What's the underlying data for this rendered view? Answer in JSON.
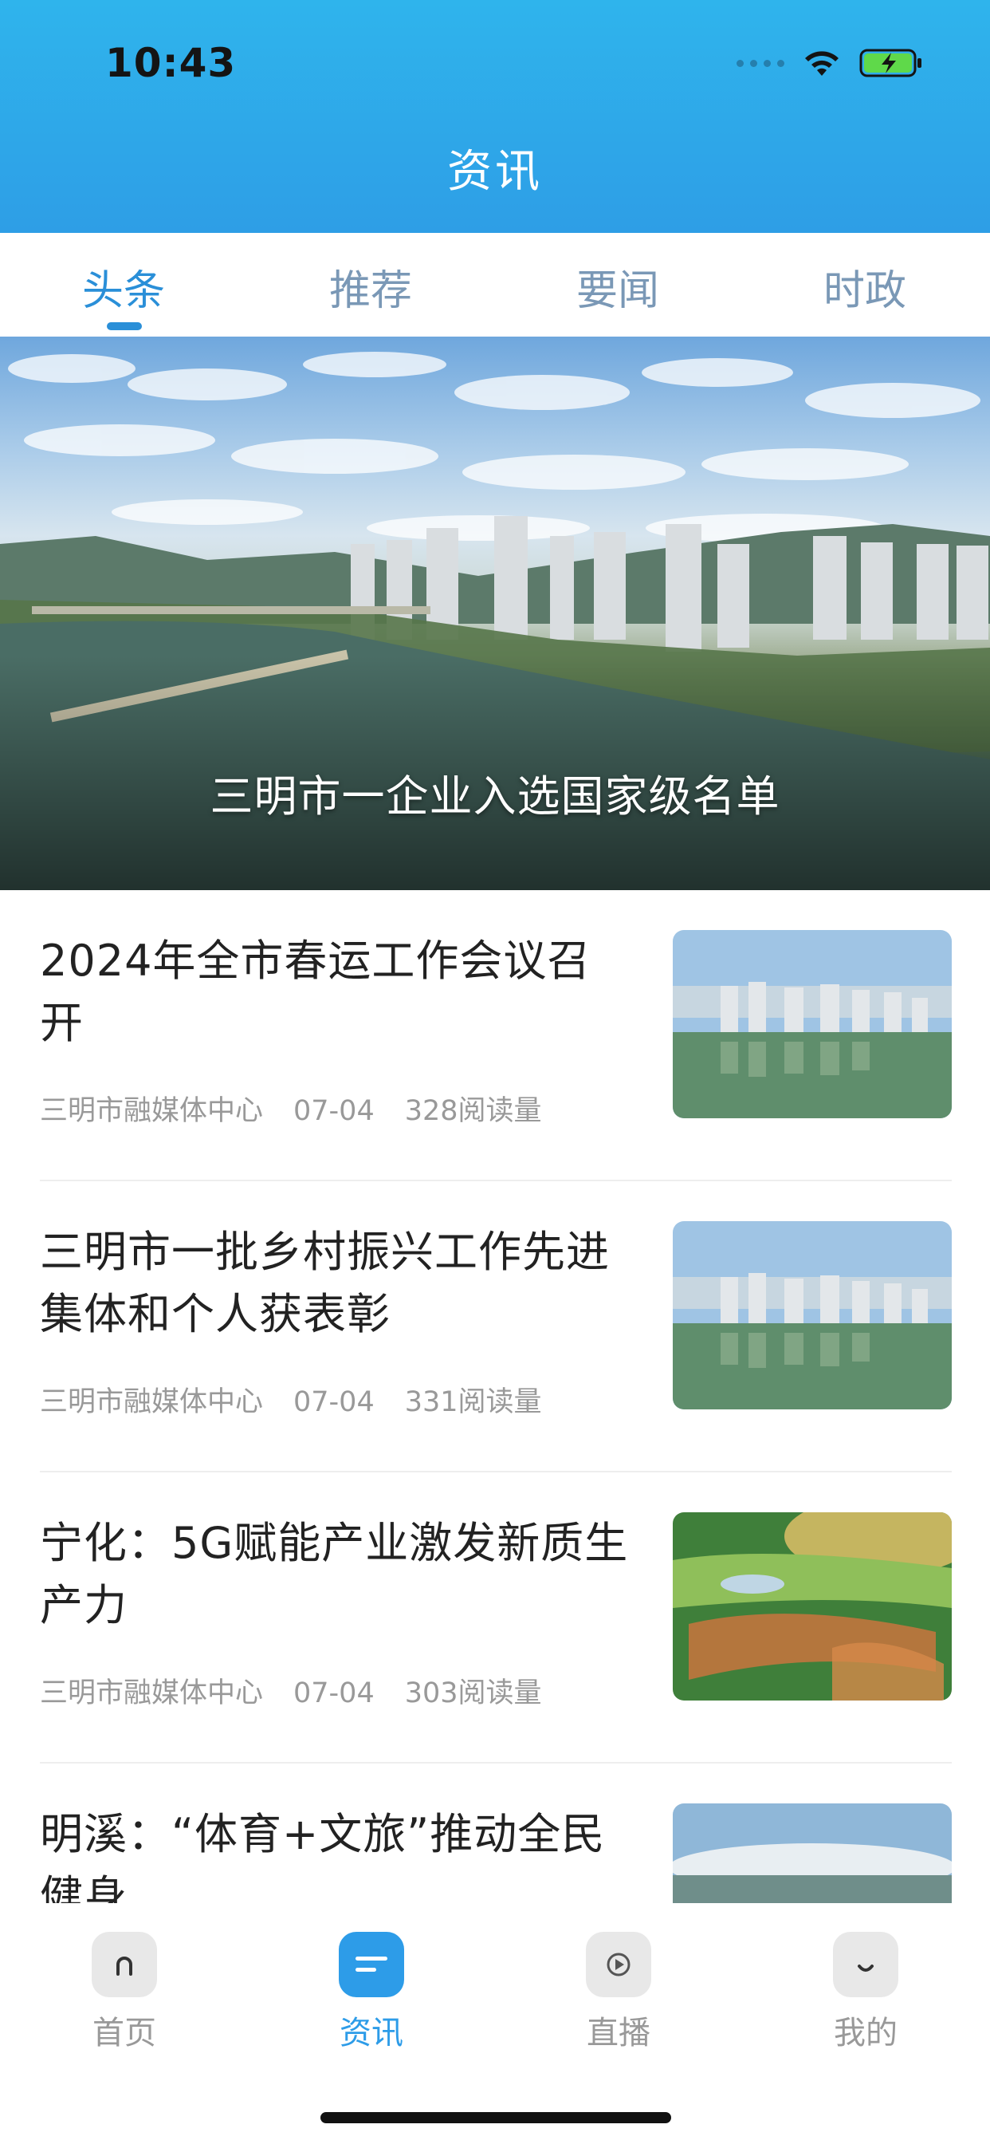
{
  "status_bar": {
    "time": "10:43"
  },
  "header": {
    "title": "资讯"
  },
  "tabs": [
    {
      "label": "头条",
      "active": true
    },
    {
      "label": "推荐",
      "active": false
    },
    {
      "label": "要闻",
      "active": false
    },
    {
      "label": "时政",
      "active": false
    }
  ],
  "hero": {
    "caption": "三明市一企业入选国家级名单"
  },
  "news": [
    {
      "title": "2024年全市春运工作会议召开",
      "source": "三明市融媒体中心",
      "date": "07-04",
      "reads": "328阅读量"
    },
    {
      "title": "三明市一批乡村振兴工作先进集体和个人获表彰",
      "source": "三明市融媒体中心",
      "date": "07-04",
      "reads": "331阅读量"
    },
    {
      "title": "宁化：5G赋能产业激发新质生产力",
      "source": "三明市融媒体中心",
      "date": "07-04",
      "reads": "303阅读量"
    },
    {
      "title": "明溪：“体育+文旅”推动全民健身",
      "source": "",
      "date": "",
      "reads": ""
    }
  ],
  "tabbar": [
    {
      "label": "首页",
      "icon": "home-icon",
      "active": false
    },
    {
      "label": "资讯",
      "icon": "news-icon",
      "active": true
    },
    {
      "label": "直播",
      "icon": "play-icon",
      "active": false
    },
    {
      "label": "我的",
      "icon": "profile-icon",
      "active": false
    }
  ],
  "colors": {
    "header": "#2fb4ec",
    "accent": "#2d9ce8",
    "tab_inactive": "#7a98b6"
  }
}
